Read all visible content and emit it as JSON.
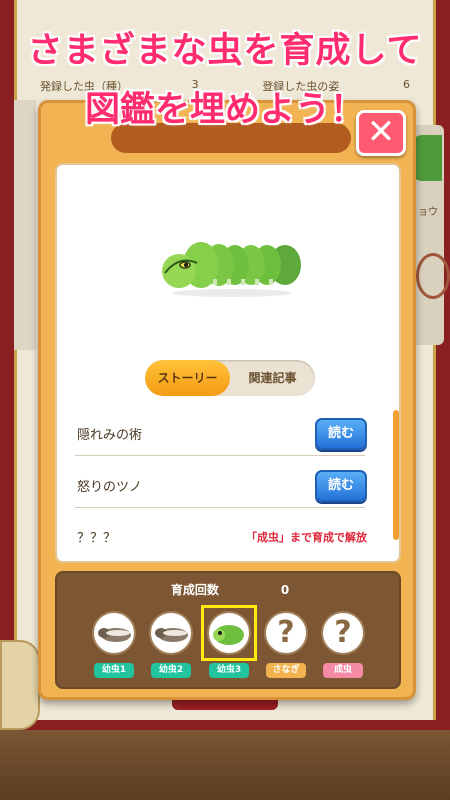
{
  "banner": {
    "line1": "さまざまな虫を育成して",
    "line2": "図鑑を埋めよう！"
  },
  "background": {
    "stats_left_label": "発録した虫（種）",
    "stats_left_value": "3",
    "stats_right_label": "登録した虫の姿",
    "stats_right_value": "6",
    "card_text": "ョウ"
  },
  "modal": {
    "close_label": "✕",
    "tabs": [
      {
        "label": "ストーリー",
        "active": true
      },
      {
        "label": "関連記事",
        "active": false
      }
    ],
    "stories": [
      {
        "title": "隠れみの術",
        "action": "読む"
      },
      {
        "title": "怒りのツノ",
        "action": "読む"
      },
      {
        "title": "？？？",
        "lock_note": "「成虫」まで育成で解放"
      }
    ],
    "growth": {
      "label": "育成回数",
      "count": "0",
      "stages": [
        {
          "label": "幼虫1",
          "icon": "larva-brown-icon",
          "color": "#22c4a0",
          "known": true
        },
        {
          "label": "幼虫2",
          "icon": "larva-brown-icon",
          "color": "#22c4a0",
          "known": true
        },
        {
          "label": "幼虫3",
          "icon": "larva-green-icon",
          "color": "#22c4a0",
          "known": true,
          "selected": true
        },
        {
          "label": "さなぎ",
          "icon": "question-icon",
          "color": "#f2b24e",
          "known": false,
          "mark": "?"
        },
        {
          "label": "成虫",
          "icon": "question-icon",
          "color": "#f58aa7",
          "known": false,
          "mark": "?"
        }
      ]
    }
  },
  "colors": {
    "banner_text": "#ff2d6f",
    "modal_bg": "#f2b452",
    "read_button": "#2372d9",
    "lock_note": "#e0283c",
    "growth_panel": "#7d5733",
    "selected_frame": "#ffe814"
  }
}
